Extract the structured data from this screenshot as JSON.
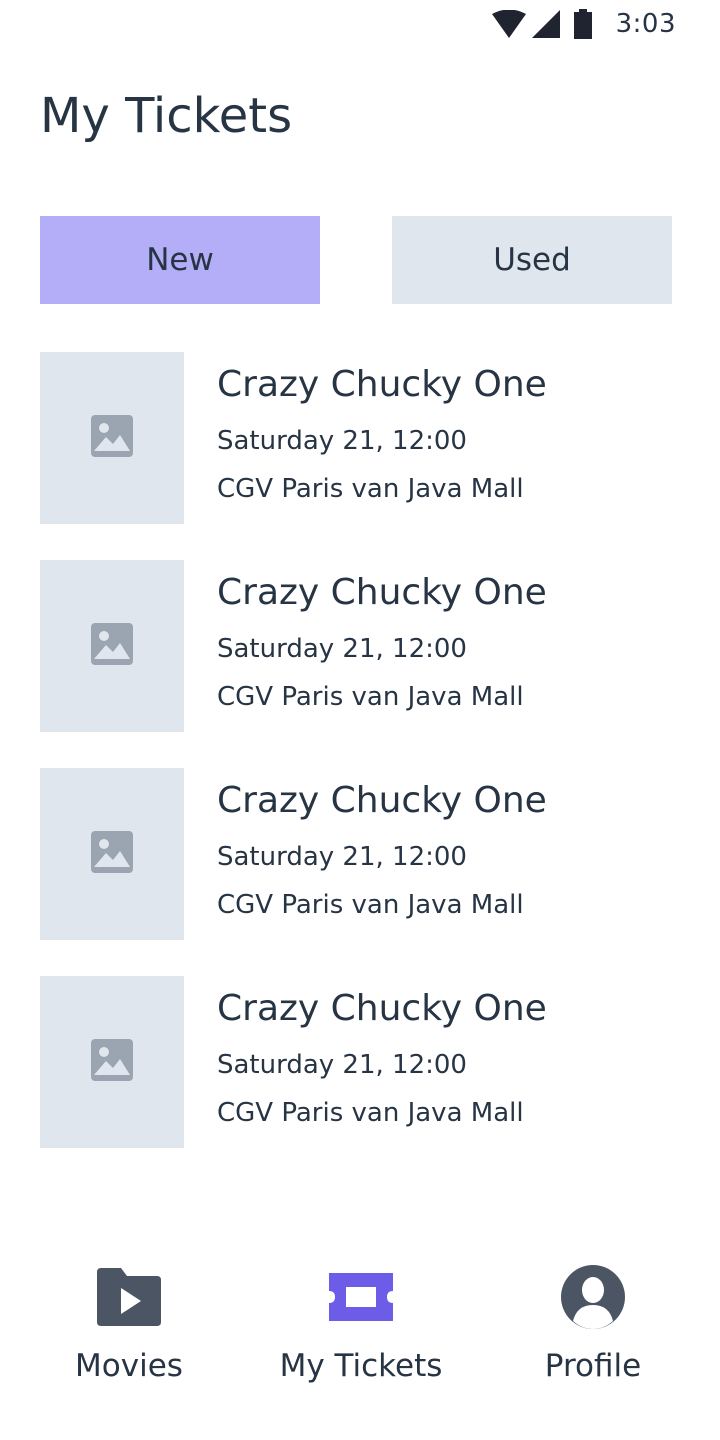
{
  "status_bar": {
    "time": "3:03",
    "icons": [
      "wifi-icon",
      "signal-icon",
      "battery-icon"
    ]
  },
  "page": {
    "title": "My Tickets"
  },
  "tabs": [
    {
      "label": "New",
      "active": true,
      "color": "#b4aef8"
    },
    {
      "label": "Used",
      "active": false,
      "color": "#e0e6ed"
    }
  ],
  "tickets": [
    {
      "title": "Crazy Chucky One",
      "time": "Saturday 21, 12:00",
      "venue": "CGV Paris van Java Mall",
      "thumbnail_icon": "image-placeholder-icon"
    },
    {
      "title": "Crazy Chucky One",
      "time": "Saturday 21, 12:00",
      "venue": "CGV Paris van Java Mall",
      "thumbnail_icon": "image-placeholder-icon"
    },
    {
      "title": "Crazy Chucky One",
      "time": "Saturday 21, 12:00",
      "venue": "CGV Paris van Java Mall",
      "thumbnail_icon": "image-placeholder-icon"
    },
    {
      "title": "Crazy Chucky One",
      "time": "Saturday 21, 12:00",
      "venue": "CGV Paris van Java Mall",
      "thumbnail_icon": "image-placeholder-icon"
    }
  ],
  "bottom_nav": [
    {
      "label": "Movies",
      "icon": "movie-folder-icon",
      "active": false
    },
    {
      "label": "My Tickets",
      "icon": "ticket-icon",
      "active": true
    },
    {
      "label": "Profile",
      "icon": "profile-icon",
      "active": false
    }
  ],
  "colors": {
    "text": "#273444",
    "accent": "#6c5ce7",
    "active_tab": "#b4aef8",
    "inactive_tab": "#e0e6ed",
    "placeholder": "#e0e6ed",
    "placeholder_icon": "#9aa5b1",
    "nav_icon": "#4b5563"
  }
}
